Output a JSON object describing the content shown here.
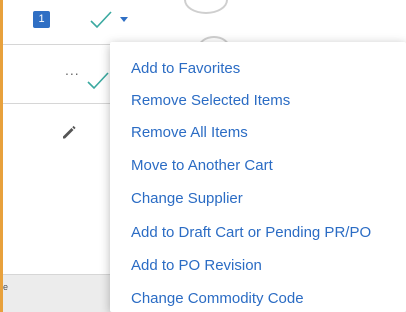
{
  "row1": {
    "badge_count": "1"
  },
  "row2": {
    "ellipsis": "..."
  },
  "row4": {
    "stub_text": "e"
  },
  "colors": {
    "accent_blue": "#2b6cc4",
    "badge_blue": "#2f6fc4",
    "check_teal": "#3aa9a0",
    "edge_orange": "#e8a13c"
  },
  "icons": [
    "check-icon",
    "chevron-down-icon",
    "more-ellipsis-icon",
    "pencil-icon"
  ],
  "menu": {
    "items": [
      {
        "label": "Add to Favorites"
      },
      {
        "label": "Remove Selected Items"
      },
      {
        "label": "Remove All Items"
      },
      {
        "label": "Move to Another Cart"
      },
      {
        "label": "Change Supplier"
      },
      {
        "label": "Add to Draft Cart or Pending PR/PO"
      },
      {
        "label": "Add to PO Revision"
      },
      {
        "label": "Change Commodity Code"
      }
    ]
  }
}
